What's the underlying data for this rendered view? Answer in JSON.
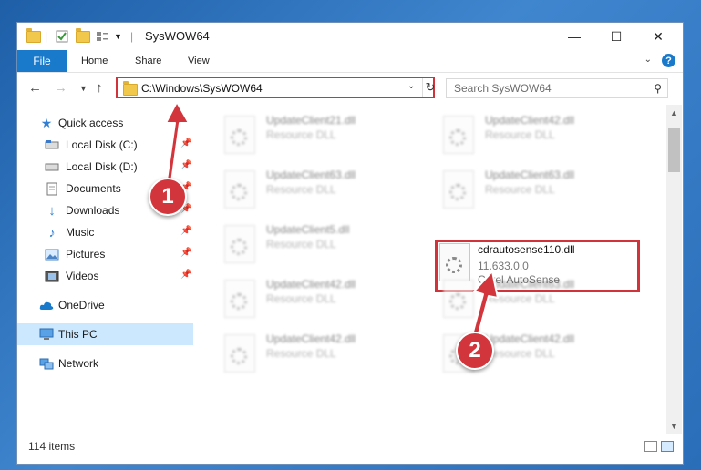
{
  "window": {
    "title": "SysWOW64",
    "controls": {
      "minimize": "—",
      "maximize": "☐",
      "close": "✕"
    }
  },
  "ribbon": {
    "file": "File",
    "tabs": [
      "Home",
      "Share",
      "View"
    ],
    "help": "?"
  },
  "address": {
    "path": "C:\\Windows\\SysWOW64",
    "dropdown": "⌄",
    "refresh": "↻"
  },
  "search": {
    "placeholder": "Search SysWOW64"
  },
  "nav": {
    "quick_access": "Quick access",
    "items": [
      {
        "label": "Local Disk (C:)",
        "pinned": true
      },
      {
        "label": "Local Disk (D:)",
        "pinned": true
      },
      {
        "label": "Documents",
        "pinned": true
      },
      {
        "label": "Downloads",
        "pinned": true
      },
      {
        "label": "Music",
        "pinned": true
      },
      {
        "label": "Pictures",
        "pinned": true
      },
      {
        "label": "Videos",
        "pinned": true
      }
    ],
    "onedrive": "OneDrive",
    "thispc": "This PC",
    "network": "Network"
  },
  "files": [
    {
      "name": "UpdateClient21.dll",
      "desc": "Resource DLL"
    },
    {
      "name": "UpdateClient42.dll",
      "desc": "Resource DLL"
    },
    {
      "name": "UpdateClient63.dll",
      "desc": "Resource DLL"
    },
    {
      "name": "UpdateClient63.dll",
      "desc": "Resource DLL"
    },
    {
      "name": "UpdateClient5.dll",
      "desc": "Resource DLL"
    },
    {
      "name": "cdrautosense110.dll",
      "version": "11.633.0.0",
      "desc": "Corel AutoSense"
    },
    {
      "name": "UpdateClient42.dll",
      "desc": "Resource DLL"
    },
    {
      "name": "UpdateClient63.dll",
      "desc": "Resource DLL"
    },
    {
      "name": "UpdateClient42.dll",
      "desc": "Resource DLL"
    },
    {
      "name": "UpdateClient42.dll",
      "desc": "Resource DLL"
    }
  ],
  "status": {
    "count": "114 items"
  },
  "callouts": {
    "one": "1",
    "two": "2"
  },
  "colors": {
    "accent": "#1979ca",
    "highlight": "#d0343a",
    "selection": "#cce8ff"
  }
}
